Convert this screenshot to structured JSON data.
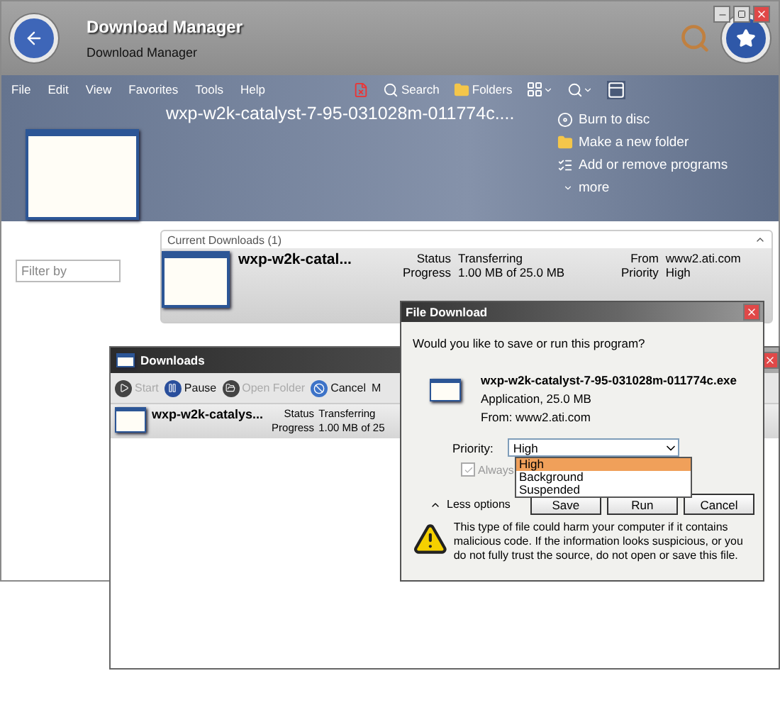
{
  "main_window": {
    "title": "Download Manager",
    "subtitle": "Download Manager",
    "menu": [
      "File",
      "Edit",
      "View",
      "Favorites",
      "Tools",
      "Help"
    ],
    "toolbar": [
      {
        "kind": "delete"
      },
      {
        "kind": "search",
        "label": "Search"
      },
      {
        "kind": "folders",
        "label": "Folders"
      },
      {
        "kind": "views"
      },
      {
        "kind": "zoom"
      },
      {
        "kind": "pane"
      }
    ],
    "file_title": "wxp-w2k-catalyst-7-95-031028m-011774c....",
    "tasks": [
      {
        "kind": "burn",
        "label": "Burn to disc"
      },
      {
        "kind": "folder",
        "label": "Make a new folder"
      },
      {
        "kind": "programs",
        "label": "Add or remove programs"
      },
      {
        "kind": "more",
        "label": "more"
      }
    ],
    "filter": {
      "placeholder": "Filter by"
    },
    "group": {
      "title": "Current Downloads (1)",
      "expanded": true
    },
    "download": {
      "name": "wxp-w2k-catal...",
      "fields": [
        {
          "label": "Status",
          "value": "Transferring"
        },
        {
          "label": "Progress",
          "value": "1.00 MB of 25.0 MB"
        },
        {
          "label": "From",
          "value": "www2.ati.com"
        },
        {
          "label": "Priority",
          "value": "High"
        }
      ]
    }
  },
  "downloads_window": {
    "title": "Downloads",
    "toolbar": [
      {
        "kind": "start",
        "label": "Start",
        "disabled": true
      },
      {
        "kind": "pause",
        "label": "Pause",
        "disabled": false
      },
      {
        "kind": "open",
        "label": "Open Folder",
        "disabled": true
      },
      {
        "kind": "cancel",
        "label": "Cancel",
        "disabled": false
      },
      {
        "kind": "text",
        "label": "M",
        "disabled": false
      }
    ],
    "row": {
      "name": "wxp-w2k-catalys...",
      "fields": [
        {
          "label": "Status",
          "value": "Transferring"
        },
        {
          "label": "Progress",
          "value": "1.00 MB of 25"
        }
      ]
    }
  },
  "dialog": {
    "title": "File Download",
    "question": "Would you like to save or run this program?",
    "file_name": "wxp-w2k-catalyst-7-95-031028m-011774c.exe",
    "file_type": "Application, 25.0 MB",
    "file_from": "From:  www2.ati.com",
    "priority_label": "Priority:",
    "priority_value": "High",
    "options": [
      {
        "label": "High",
        "selected": true
      },
      {
        "label": "Background",
        "selected": false
      },
      {
        "label": "Suspended",
        "selected": false
      }
    ],
    "always": {
      "label": "Always",
      "checked": true,
      "disabled": true
    },
    "less_options": "Less options",
    "buttons": [
      "Save",
      "Run",
      "Cancel"
    ],
    "warning": "This type of file could harm your computer if it contains malicious code.  If the information looks suspicious, or you do not fully trust the source, do not open or save this file."
  }
}
